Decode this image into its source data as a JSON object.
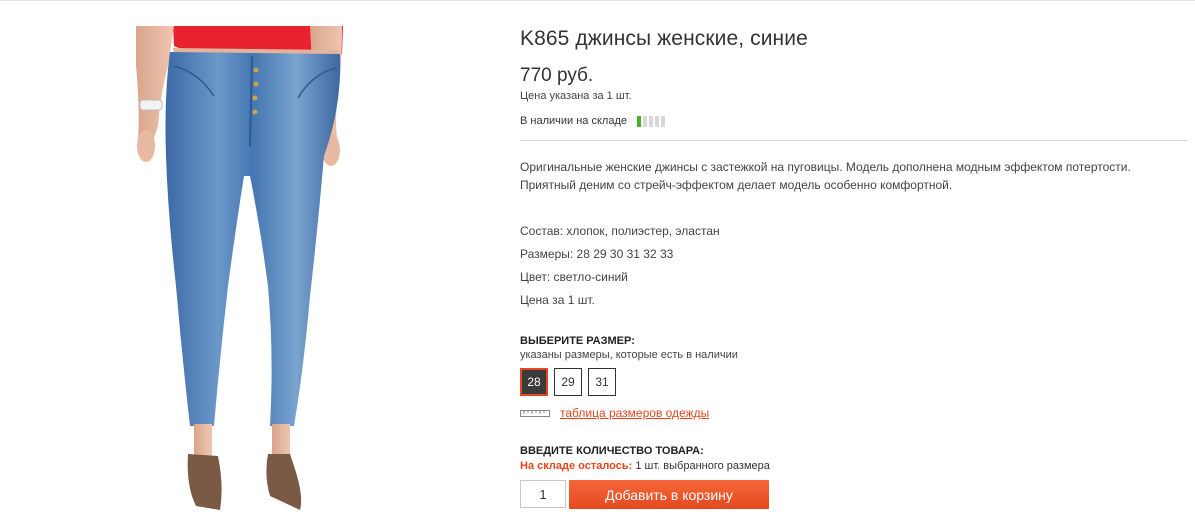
{
  "product": {
    "title": "K865 джинсы женские, синие",
    "price": "770 руб.",
    "price_note": "Цена указана за 1 шт.",
    "stock_label": "В наличии на складе",
    "stock_level": 0.2,
    "description": "Оригинальные женские джинсы с застежкой на пуговицы. Модель дополнена модным эффектом потертости. Приятный деним со стрейч-эффектом делает модель особенно комфортной.",
    "specs": {
      "composition": "Состав: хлопок, полиэстер, эластан",
      "sizes": "Размеры: 28 29 30 31 32 33",
      "color": "Цвет: светло-синий",
      "price_per": "Цена за 1 шт."
    }
  },
  "size_selector": {
    "heading": "ВЫБЕРИТЕ РАЗМЕР:",
    "subtitle": "указаны размеры, которые есть в наличии",
    "options": [
      "28",
      "29",
      "31"
    ],
    "selected": "28",
    "size_chart_link": "таблица размеров одежды"
  },
  "quantity": {
    "heading": "ВВЕДИТЕ КОЛИЧЕСТВО ТОВАРА:",
    "left_label": "На складе осталось:",
    "left_value": "1 шт. выбранного размера",
    "value": "1",
    "add_button": "Добавить в корзину"
  },
  "colors": {
    "accent": "#e5461e",
    "stock_green": "#4caf22",
    "denim": "#4f7fb8",
    "top_red": "#e8222e"
  }
}
